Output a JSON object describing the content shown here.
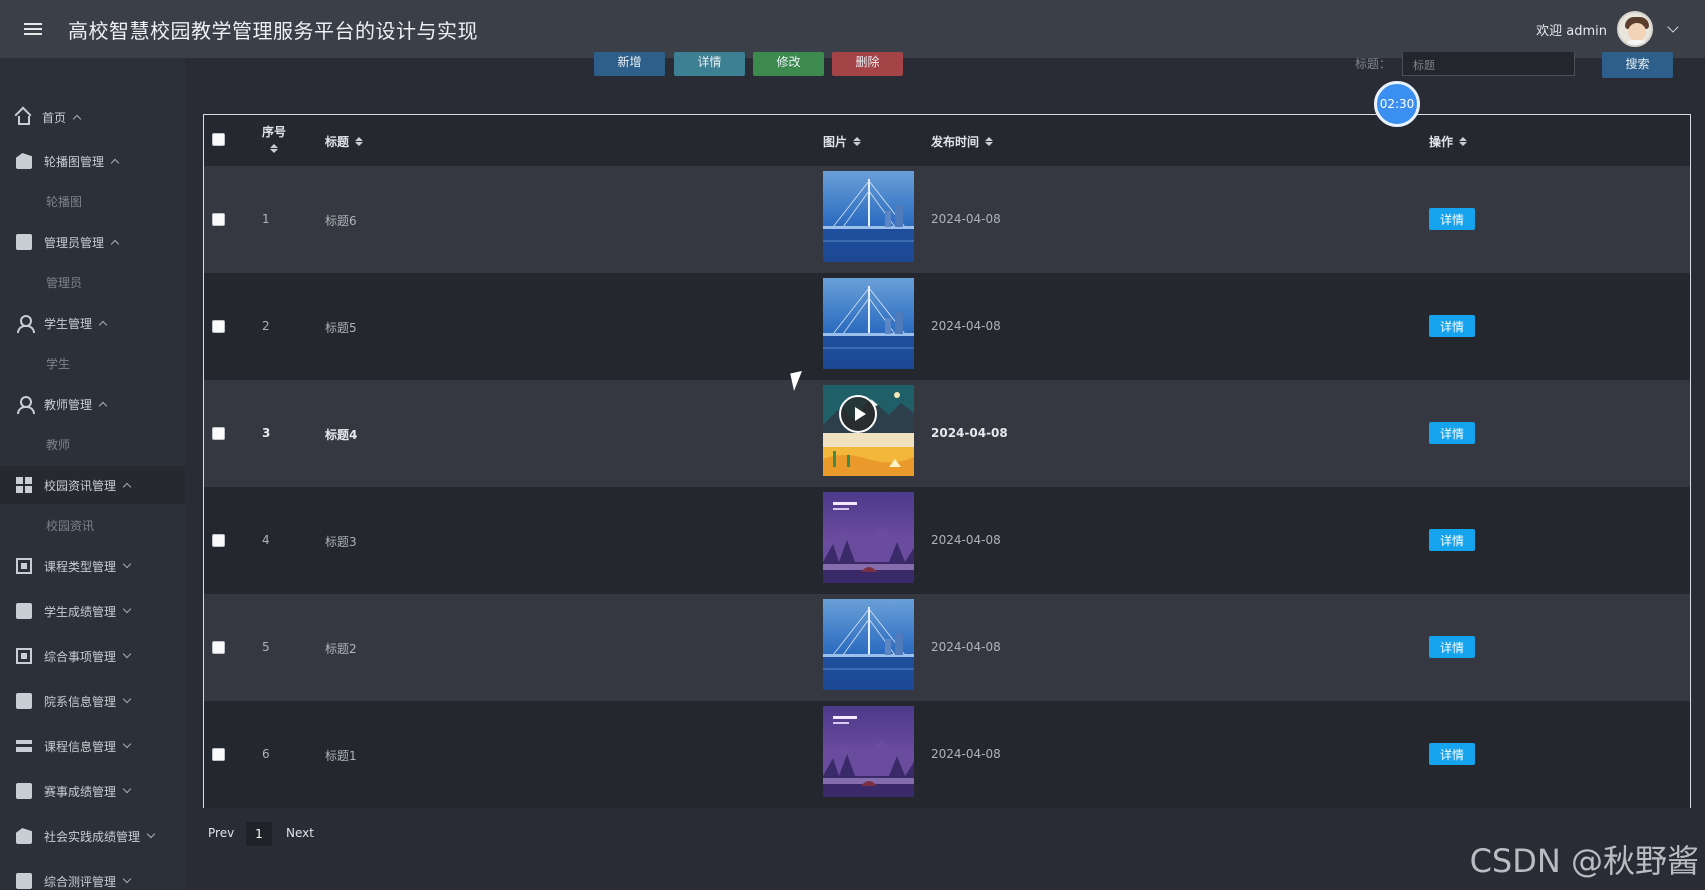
{
  "header": {
    "title": "高校智慧校园教学管理服务平台的设计与实现",
    "welcome": "欢迎 admin"
  },
  "sidebar": {
    "items": [
      {
        "label": "首页",
        "icon": "home-icon",
        "expanded": true
      },
      {
        "label": "轮播图管理",
        "icon": "images-icon",
        "expanded": true,
        "sub": "轮播图"
      },
      {
        "label": "管理员管理",
        "icon": "folder-icon",
        "expanded": true,
        "sub": "管理员"
      },
      {
        "label": "学生管理",
        "icon": "user-icon",
        "expanded": true,
        "sub": "学生"
      },
      {
        "label": "教师管理",
        "icon": "person-icon",
        "expanded": true,
        "sub": "教师"
      },
      {
        "label": "校园资讯管理",
        "icon": "grid-icon",
        "expanded": true,
        "sub": "校园资讯"
      },
      {
        "label": "课程类型管理",
        "icon": "chip-icon",
        "expanded": false
      },
      {
        "label": "学生成绩管理",
        "icon": "gift-icon",
        "expanded": false
      },
      {
        "label": "综合事项管理",
        "icon": "contact-icon",
        "expanded": false
      },
      {
        "label": "院系信息管理",
        "icon": "folder-icon",
        "expanded": false
      },
      {
        "label": "课程信息管理",
        "icon": "list-icon",
        "expanded": false
      },
      {
        "label": "赛事成绩管理",
        "icon": "briefcase-icon",
        "expanded": false
      },
      {
        "label": "社会实践成绩管理",
        "icon": "images-icon",
        "expanded": false
      },
      {
        "label": "综合测评管理",
        "icon": "folder-icon",
        "expanded": false
      }
    ]
  },
  "toolbar": {
    "add": "新增",
    "detail": "详情",
    "edit": "修改",
    "delete": "删除",
    "search_label": "标题：",
    "search_placeholder": "标题",
    "search_button": "搜索",
    "colors": {
      "add": "#2e5f8a",
      "detail": "#3d7f93",
      "edit": "#3d8a4f",
      "delete": "#a44447"
    }
  },
  "timer": "02:30",
  "table": {
    "headers": {
      "index": "序号",
      "title": "标题",
      "image": "图片",
      "date": "发布时间",
      "action": "操作"
    },
    "rows": [
      {
        "index": "1",
        "title": "标题6",
        "image": "bridge-image",
        "date": "2024-04-08",
        "action": "详情"
      },
      {
        "index": "2",
        "title": "标题5",
        "image": "bridge-image",
        "date": "2024-04-08",
        "action": "详情"
      },
      {
        "index": "3",
        "title": "标题4",
        "image": "desert-video-image",
        "date": "2024-04-08",
        "action": "详情"
      },
      {
        "index": "4",
        "title": "标题3",
        "image": "summer-time-image",
        "date": "2024-04-08",
        "action": "详情"
      },
      {
        "index": "5",
        "title": "标题2",
        "image": "bridge-image",
        "date": "2024-04-08",
        "action": "详情"
      },
      {
        "index": "6",
        "title": "标题1",
        "image": "summer-time-image",
        "date": "2024-04-08",
        "action": "详情"
      }
    ]
  },
  "pagination": {
    "prev": "Prev",
    "page": "1",
    "next": "Next"
  },
  "watermark": "CSDN @秋野酱",
  "colors": {
    "header": "#3b3f48",
    "sidebar": "#2c3038",
    "accent": "#14a3ec"
  }
}
